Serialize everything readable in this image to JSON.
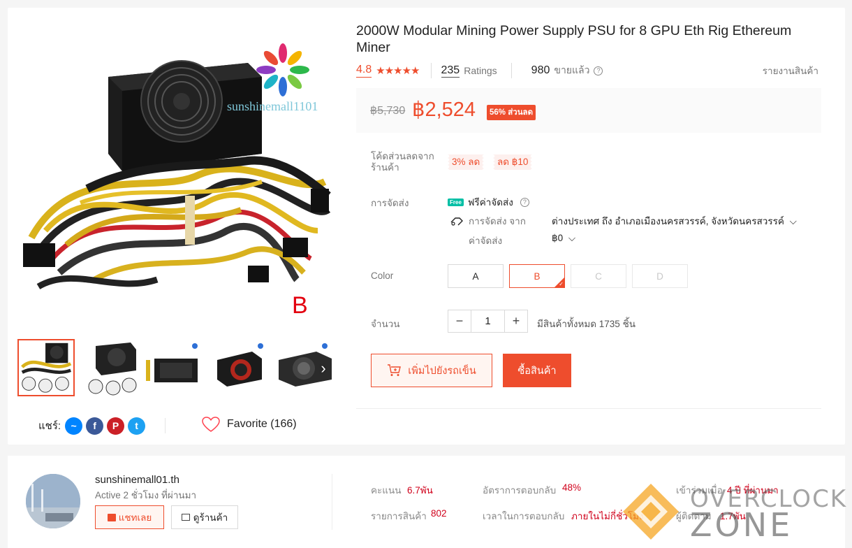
{
  "product": {
    "title": "2000W Modular Mining Power Supply PSU for 8 GPU Eth Rig Ethereum Miner",
    "image_watermark": "sunshinemall1101",
    "variant_marker": "B",
    "rating": "4.8",
    "stars": "★★★★★",
    "ratings_count": "235",
    "ratings_label": "Ratings",
    "sold_count": "980",
    "sold_label": "ขายแล้ว",
    "report_label": "รายงานสินค้า"
  },
  "price": {
    "original": "฿5,730",
    "current": "฿2,524",
    "discount": "56% ส่วนลด"
  },
  "voucher": {
    "label": "โค้ดส่วนลดจากร้านค้า",
    "items": [
      "3% ลด",
      "ลด ฿10"
    ]
  },
  "shipping": {
    "label": "การจัดส่ง",
    "free_tag": "Free",
    "free_label": "ฟรีค่าจัดส่ง",
    "from_label": "การจัดส่ง จาก",
    "destination": "ต่างประเทศ ถึง อำเภอเมืองนครสวรรค์, จังหวัดนครสวรรค์",
    "cost_label": "ค่าจัดส่ง",
    "cost_value": "฿0"
  },
  "color": {
    "label": "Color",
    "options": [
      "A",
      "B",
      "C",
      "D"
    ],
    "selected": "B"
  },
  "quantity": {
    "label": "จำนวน",
    "value": "1",
    "minus": "−",
    "plus": "+",
    "stock": "มีสินค้าทั้งหมด 1735 ชิ้น"
  },
  "actions": {
    "add_to_cart": "เพิ่มไปยังรถเข็น",
    "buy_now": "ซื้อสินค้า"
  },
  "share": {
    "label": "แชร์:",
    "networks": [
      "messenger-icon",
      "facebook-icon",
      "pinterest-icon",
      "twitter-icon"
    ],
    "favorite_label": "Favorite (166)"
  },
  "shop": {
    "name": "sunshinemall01.th",
    "active": "Active 2 ชั่วโมง ที่ผ่านมา",
    "chat_label": "แชทเลย",
    "view_label": "ดูร้านค้า",
    "stats": [
      {
        "label": "คะแนน",
        "value": "6.7พัน"
      },
      {
        "label": "รายการสินค้า",
        "value": "802"
      },
      {
        "label": "อัตราการตอบกลับ",
        "value": "48%"
      },
      {
        "label": "เวลาในการตอบกลับ",
        "value": "ภายในไม่กี่ชั่วโมง"
      },
      {
        "label": "เข้าร่วมเมื่อ",
        "value": "4 ปี ที่ผ่านมา"
      },
      {
        "label": "ผู้ติดตาม",
        "value": "1.7พัน"
      }
    ]
  },
  "watermark": {
    "line1": "OVERCLOCK",
    "line2": "ZONE"
  },
  "colors": {
    "accent": "#ee4d2d",
    "background": "#f5f5f5",
    "free_ship": "#00bfa5"
  }
}
